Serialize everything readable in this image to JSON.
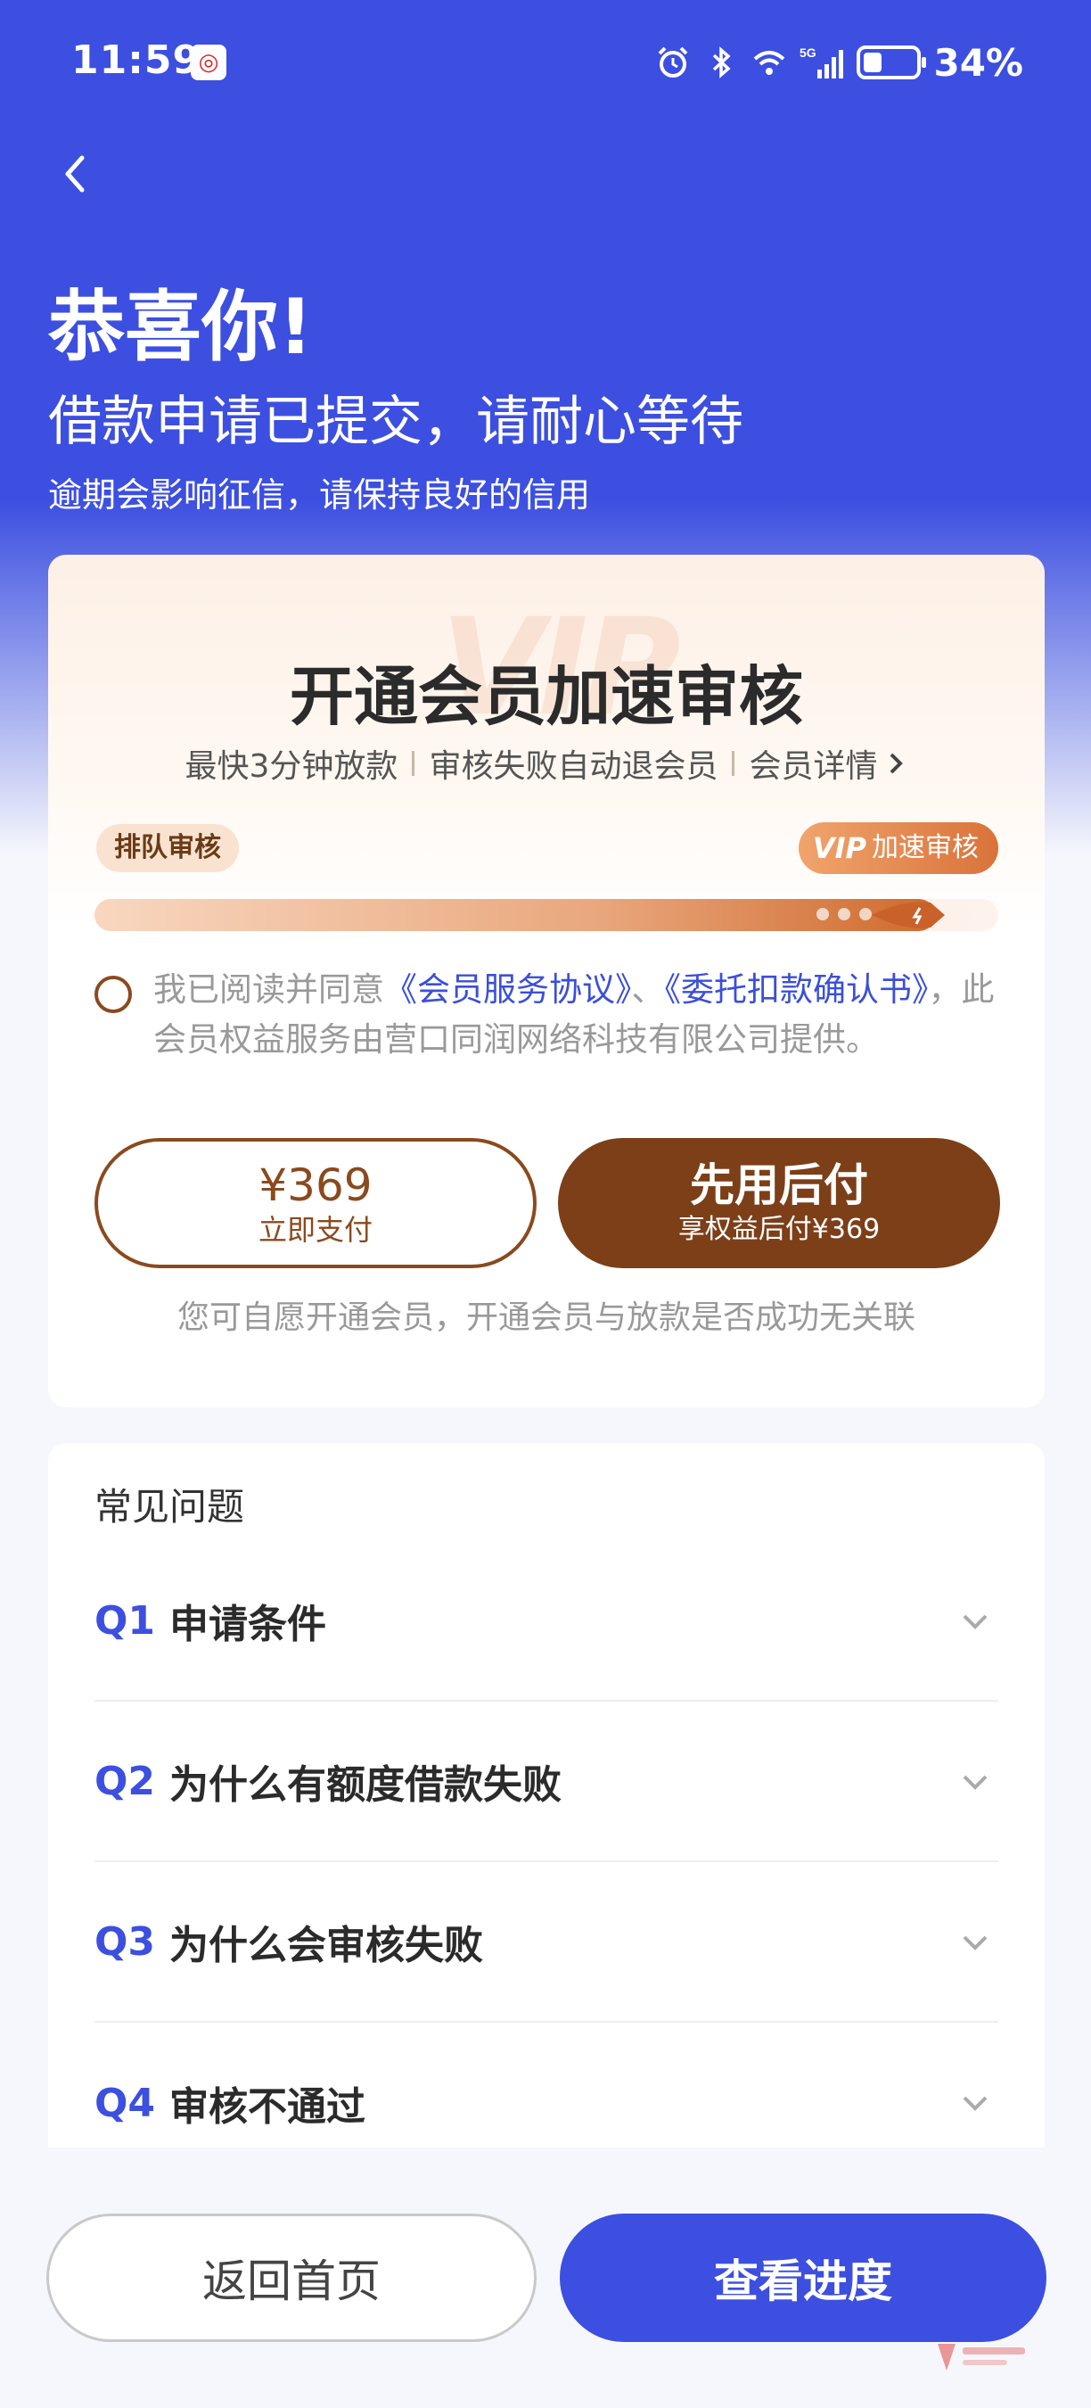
{
  "status_bar": {
    "time": "11:59",
    "battery_percent": "34%",
    "network": "5G"
  },
  "header": {
    "title": "恭喜你!",
    "headline": "借款申请已提交，请耐心等待",
    "subline": "逾期会影响征信，请保持良好的信用"
  },
  "vip_card": {
    "watermark": "VIP",
    "title": "开通会员加速审核",
    "features": [
      "最快3分钟放款",
      "审核失败自动退会员"
    ],
    "details_link": "会员详情",
    "queue_label": "排队审核",
    "speed_label_mark": "VIP",
    "speed_label": "加速审核",
    "progress": 0.93,
    "agreement": {
      "prefix": "我已阅读并同意",
      "link1": "《会员服务协议》",
      "joiner": "、",
      "link2": "《委托扣款确认书》",
      "suffix": "，此会员权益服务由营口同润网络科技有限公司提供。"
    },
    "pay_now": {
      "price": "¥369",
      "label": "立即支付"
    },
    "pay_later": {
      "label": "先用后付",
      "sub": "享权益后付¥369"
    },
    "note": "您可自愿开通会员，开通会员与放款是否成功无关联"
  },
  "faq": {
    "title": "常见问题",
    "items": [
      {
        "q": "Q1",
        "text": "申请条件"
      },
      {
        "q": "Q2",
        "text": "为什么有额度借款失败"
      },
      {
        "q": "Q3",
        "text": "为什么会审核失败"
      },
      {
        "q": "Q4",
        "text": "审核不通过"
      }
    ]
  },
  "bottom": {
    "home_label": "返回首页",
    "progress_label": "查看进度"
  },
  "colors": {
    "primary": "#3c4fe0",
    "vip_brown": "#7c3f18",
    "link": "#3b4fd8"
  }
}
